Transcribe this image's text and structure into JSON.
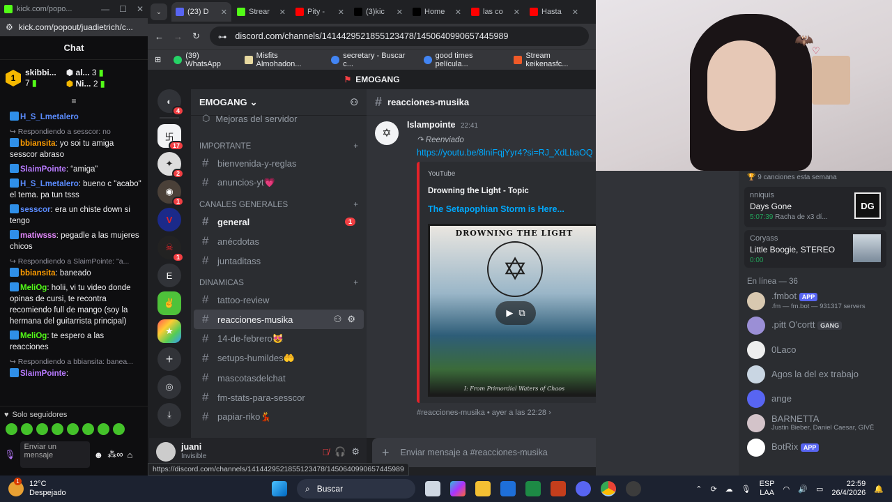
{
  "kick": {
    "tab_url": "kick.com/popo...",
    "url": "kick.com/popout/juadietrich/c...",
    "title": "Chat",
    "leaders": [
      {
        "name": "skibbi...",
        "count": "7"
      },
      {
        "name": "al...",
        "count": "3"
      },
      {
        "name": "Ni...",
        "count": "2"
      }
    ],
    "messages": [
      {
        "user": "H_S_Lmetalero",
        "color": "#5b8cff",
        "text": "",
        "reply": ""
      },
      {
        "reply": "Respondiendo a sesscor: no",
        "user": "bbiansita",
        "color": "#ff9d00",
        "text": ": yo soi tu amiga sesscor abraso"
      },
      {
        "reply": "",
        "user": "SlaimPointe",
        "color": "#b87aff",
        "text": ": “amiga”"
      },
      {
        "reply": "",
        "user": "H_S_Lmetalero",
        "color": "#5b8cff",
        "text": ": bueno c \"acabo\" el tema. pa tun tsss"
      },
      {
        "reply": "",
        "user": "sesscor",
        "color": "#5b8cff",
        "text": ": era un chiste down si tengo"
      },
      {
        "reply": "",
        "user": "matiwsss",
        "color": "#e68aff",
        "text": ": pegadle a las mujeres chicos"
      },
      {
        "reply": "Respondiendo a SlaimPointe: \"a...",
        "user": "bbiansita",
        "color": "#ff9d00",
        "text": ": baneado"
      },
      {
        "reply": "",
        "user": "MeliOg",
        "color": "#53fc18",
        "text": ": holii, vi tu video donde opinas de cursi, te recontra recomiendo full de mango (soy la hermana del guitarrista principal)"
      },
      {
        "reply": "",
        "user": "MeliOg",
        "color": "#53fc18",
        "text": ": te espero a las reacciones"
      },
      {
        "reply": "Respondiendo a bbiansita: banea...",
        "user": "SlaimPointe",
        "color": "#b87aff",
        "text": ":"
      }
    ],
    "followers_only": "Solo seguidores",
    "send_placeholder": "Enviar un mensaje"
  },
  "chrome": {
    "tabs": [
      {
        "label": "(23) D",
        "color": "#5865f2"
      },
      {
        "label": "Strear",
        "color": "#53fc18"
      },
      {
        "label": "Pity -",
        "color": "#ff0000"
      },
      {
        "label": "(3)kic",
        "color": "#000000"
      },
      {
        "label": "Home",
        "color": "#000000"
      },
      {
        "label": "las co",
        "color": "#ff0000"
      },
      {
        "label": "Hasta",
        "color": "#ff0000"
      }
    ],
    "url": "discord.com/channels/1414429521855123478/1450640990657445989",
    "bookmarks": [
      "(39) WhatsApp",
      "Misfits Almohadon...",
      "secretary - Buscar c...",
      "good times película...",
      "Stream keikenasfc..."
    ],
    "status_url": "https://discord.com/channels/1414429521855123478/1450640990657445989"
  },
  "discord": {
    "server_title": "EMOGANG",
    "server_name": "EMOGANG",
    "server_badges": [
      "4",
      "17",
      "2",
      "1",
      "",
      "1",
      "",
      "",
      ""
    ],
    "boost_item": "Mejoras del servidor",
    "categories": {
      "important": "IMPORTANTE",
      "general": "CANALES GENERALES",
      "dinamicas": "DINAMICAS"
    },
    "channels_important": [
      "bienvenida-y-reglas",
      "anuncios-yt💗"
    ],
    "channels_general": [
      "general",
      "anécdotas",
      "juntaditass"
    ],
    "general_badge": "1",
    "channels_dinamicas": [
      "tattoo-review",
      "reacciones-musika",
      "14-de-febrero😻",
      "setups-humildes🤲",
      "mascotasdelchat",
      "fm-stats-para-sesscor",
      "papiar-riko💃"
    ],
    "current_channel": "reacciones-musika",
    "user": {
      "name": "juani",
      "status": "Invisible"
    },
    "message": {
      "author": "Islampointe",
      "time": "22:41",
      "forwarded": "Reenviado",
      "link": "https://youtu.be/8lniFqjYyr4?si=RJ_XdLbaOQ",
      "provider": "YouTube",
      "embed_author": "Drowning the Light - Topic",
      "embed_title": "The Setapophian Storm is Here...",
      "album_top": "DROWNING THE LIGHT",
      "album_bottom": "I: From Primordial Waters of Chaos",
      "footer": "#reacciones-musika • ayer a las 22:28 ›"
    },
    "composer_placeholder": "Enviar mensaje a #reacciones-musika",
    "members": {
      "activity_top": "9 canciones esta semana",
      "activities": [
        {
          "user": "nniquis",
          "title": "Days Gone",
          "time": "5:07:39",
          "extra": "Racha de x3 dí..."
        },
        {
          "user": "Coryass",
          "title": "Little Boogie, STEREO",
          "time": "0:00",
          "extra": ""
        }
      ],
      "online_header": "En línea — 36",
      "list": [
        {
          "name": ".fmbot",
          "badge": "APP",
          "sub": ".fm — fm.bot — 931317 servers"
        },
        {
          "name": ".pitt O'cortt",
          "badge": "GANG",
          "sub": ""
        },
        {
          "name": "0Laco",
          "badge": "",
          "sub": ""
        },
        {
          "name": "Agos la del ex trabajo",
          "badge": "",
          "sub": ""
        },
        {
          "name": "ange",
          "badge": "",
          "sub": ""
        },
        {
          "name": "BARNETTA",
          "badge": "",
          "sub": "Justin Bieber, Daniel Caesar, GIVĒ"
        },
        {
          "name": "BotRix",
          "badge": "APP",
          "sub": ""
        }
      ]
    }
  },
  "taskbar": {
    "weather_temp": "12°C",
    "weather_desc": "Despejado",
    "search": "Buscar",
    "lang": "ESP",
    "lang2": "LAA",
    "time": "22:59",
    "date": "26/4/2026",
    "weather_badge": "1"
  }
}
